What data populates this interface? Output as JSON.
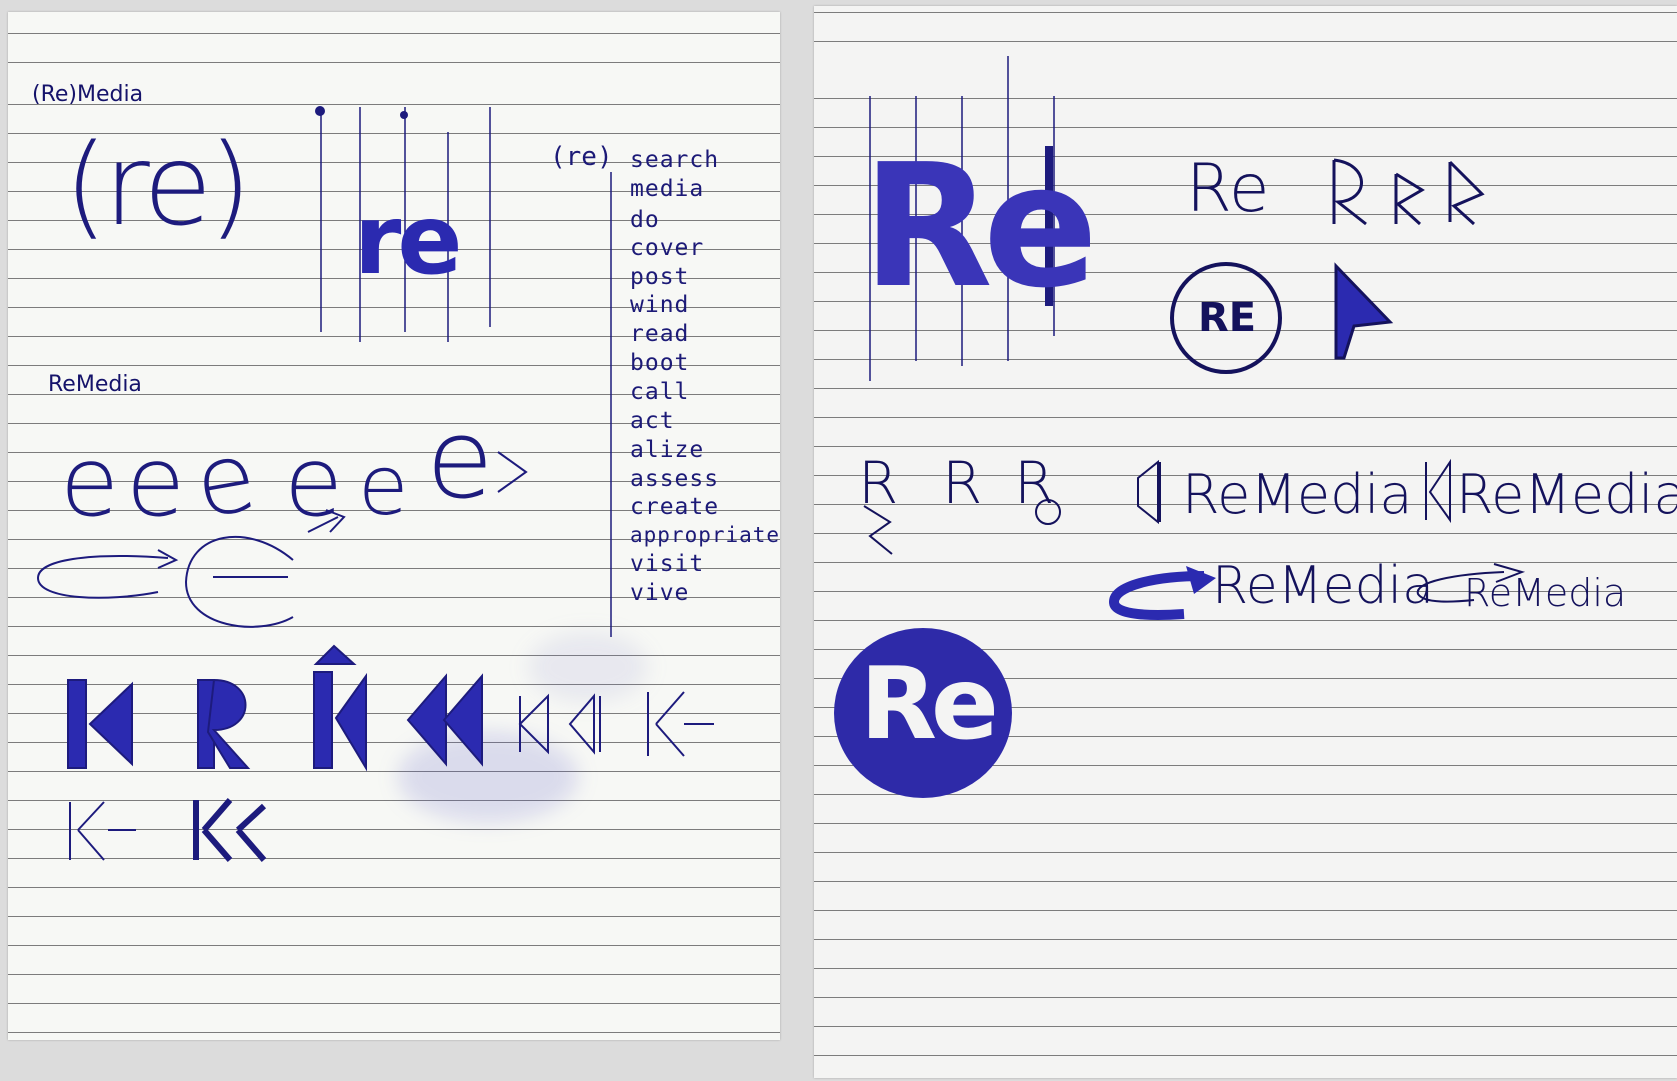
{
  "sheet_left": {
    "header_label": "(Re)Media",
    "bracket_word": "(re)",
    "bracket_big_word": "re",
    "grid_word": "re",
    "prefix": "(re)",
    "suffixes": [
      "search",
      "media",
      "do",
      "cover",
      "post",
      "wind",
      "read",
      "boot",
      "call",
      "act",
      "alize",
      "assess",
      "create",
      "appropriate",
      "visit",
      "vive"
    ],
    "second_label": "ReMedia",
    "e_letters": [
      "e",
      "e",
      "e",
      "e",
      "e",
      "e"
    ]
  },
  "sheet_right": {
    "big_word": "Re",
    "bar": "|",
    "small_word": "Re",
    "circle_small_text": "RE",
    "circle_big_text": "Re",
    "wordmarks": [
      "ReMedia",
      "ReMedia",
      "ReMedia",
      "ReMedia"
    ],
    "r_variants": [
      "R",
      "R",
      "R"
    ]
  },
  "colors": {
    "ink": "#2b2ab0",
    "ink_dark": "#1c1a77",
    "paper": "#f7f8f5",
    "rule_line": "#7c7c7c",
    "background": "#dcdcdc"
  }
}
